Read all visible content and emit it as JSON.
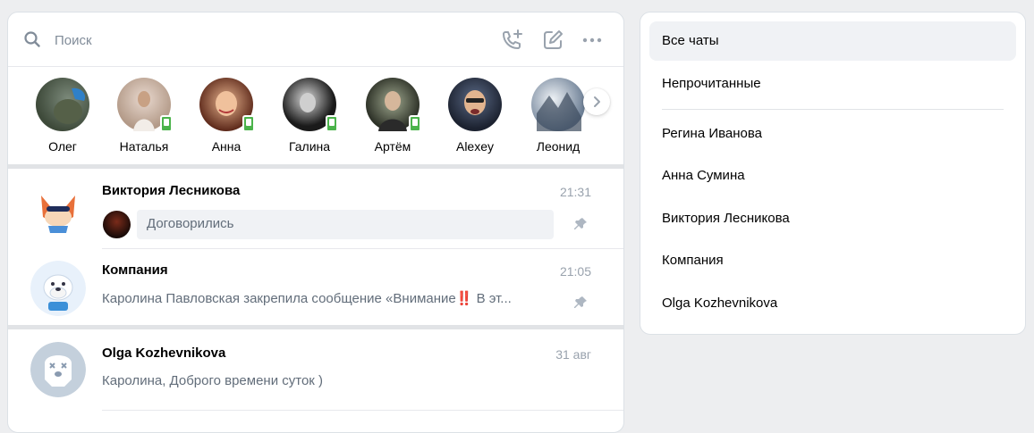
{
  "search": {
    "placeholder": "Поиск"
  },
  "header_icons": [
    "phone-plus-icon",
    "compose-icon",
    "more-icon"
  ],
  "stories": [
    {
      "name": "Олег",
      "online": false
    },
    {
      "name": "Наталья",
      "online": true
    },
    {
      "name": "Анна",
      "online": true
    },
    {
      "name": "Галина",
      "online": true
    },
    {
      "name": "Артём",
      "online": true
    },
    {
      "name": "Alexey",
      "online": false
    },
    {
      "name": "Леонид",
      "online": false
    }
  ],
  "conversations": [
    {
      "name": "Виктория Лесникова",
      "time": "21:31",
      "text": "Договорились",
      "pinned": true
    },
    {
      "name": "Компания",
      "time": "21:05",
      "text": "Каролина Павловская закрепила сообщение «Внимание‼️ В эт...",
      "pinned": true
    },
    {
      "name": "Olga Kozhevnikova",
      "time": "31 авг",
      "text": "Каролина, Доброго времени суток )",
      "pinned": false
    }
  ],
  "sidebar": {
    "items": [
      {
        "label": "Все чаты",
        "active": true
      },
      {
        "label": "Непрочитанные",
        "active": false
      },
      {
        "label": "Регина Иванова",
        "active": false
      },
      {
        "label": "Анна Сумина",
        "active": false
      },
      {
        "label": "Виктория Лесникова",
        "active": false
      },
      {
        "label": "Компания",
        "active": false
      },
      {
        "label": "Olga Kozhevnikova",
        "active": false
      }
    ]
  },
  "colors": {
    "accent": "#2688eb",
    "online": "#4bb34b",
    "muted": "#818c99",
    "background": "#edeef0"
  }
}
